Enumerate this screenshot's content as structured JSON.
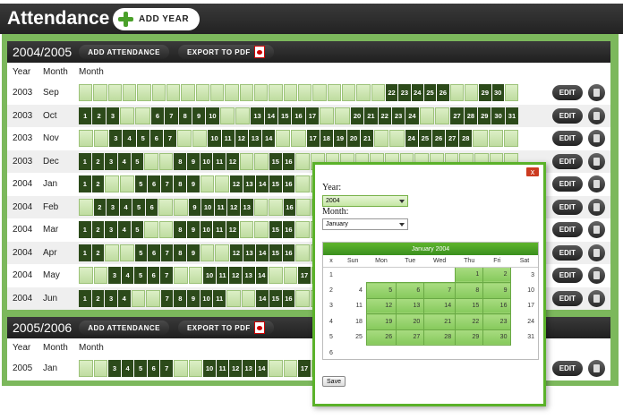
{
  "page": {
    "title": "Attendance",
    "add_year_label": "ADD YEAR"
  },
  "colors": {
    "header_bg": "#2b2b2b",
    "accent_green": "#7cb85c",
    "day_present": "#2c4a1a",
    "day_absent": "#cfe7b4"
  },
  "columns": {
    "year": "Year",
    "month": "Month",
    "days": "Month"
  },
  "section_buttons": {
    "add_attendance": "ADD ATTENDANCE",
    "export_pdf": "EXPORT TO PDF"
  },
  "row_actions": {
    "edit": "EDIT"
  },
  "sections": [
    {
      "title": "2004/2005",
      "rows": [
        {
          "year": "2003",
          "month": "Sep",
          "present": [
            22,
            23,
            24,
            25,
            26,
            29,
            30
          ]
        },
        {
          "year": "2003",
          "month": "Oct",
          "present": [
            1,
            2,
            3,
            6,
            7,
            8,
            9,
            10,
            13,
            14,
            15,
            16,
            17,
            20,
            21,
            22,
            23,
            24,
            27,
            28,
            29,
            30,
            31
          ]
        },
        {
          "year": "2003",
          "month": "Nov",
          "present": [
            3,
            4,
            5,
            6,
            7,
            10,
            11,
            12,
            13,
            14,
            17,
            18,
            19,
            20,
            21,
            24,
            25,
            26,
            27,
            28
          ]
        },
        {
          "year": "2003",
          "month": "Dec",
          "present": [
            1,
            2,
            3,
            4,
            5,
            8,
            9,
            10,
            11,
            12,
            15,
            16
          ]
        },
        {
          "year": "2004",
          "month": "Jan",
          "present": [
            1,
            2,
            5,
            6,
            7,
            8,
            9,
            12,
            13,
            14,
            15,
            16
          ]
        },
        {
          "year": "2004",
          "month": "Feb",
          "present": [
            2,
            3,
            4,
            5,
            6,
            9,
            10,
            11,
            12,
            13,
            16
          ]
        },
        {
          "year": "2004",
          "month": "Mar",
          "present": [
            1,
            2,
            3,
            4,
            5,
            8,
            9,
            10,
            11,
            12,
            15,
            16
          ]
        },
        {
          "year": "2004",
          "month": "Apr",
          "present": [
            1,
            2,
            5,
            6,
            7,
            8,
            9,
            12,
            13,
            14,
            15,
            16
          ]
        },
        {
          "year": "2004",
          "month": "May",
          "present": [
            3,
            4,
            5,
            6,
            7,
            10,
            11,
            12,
            13,
            14,
            17
          ]
        },
        {
          "year": "2004",
          "month": "Jun",
          "present": [
            1,
            2,
            3,
            4,
            7,
            8,
            9,
            10,
            11,
            14,
            15,
            16
          ]
        }
      ]
    },
    {
      "title": "2005/2006",
      "rows": [
        {
          "year": "2005",
          "month": "Jan",
          "present": [
            3,
            4,
            5,
            6,
            7,
            10,
            11,
            12,
            13,
            14,
            17
          ]
        }
      ]
    }
  ],
  "popup": {
    "close_label": "x",
    "year_label": "Year:",
    "year_value": "2004",
    "month_label": "Month:",
    "month_value": "January",
    "calendar_title": "January 2004",
    "week_col": "x",
    "weekdays": [
      "Sun",
      "Mon",
      "Tue",
      "Wed",
      "Thu",
      "Fri",
      "Sat"
    ],
    "weeks": [
      {
        "n": "1",
        "days": [
          "",
          "",
          "",
          "",
          "1",
          "2",
          "3"
        ]
      },
      {
        "n": "2",
        "days": [
          "4",
          "5",
          "6",
          "7",
          "8",
          "9",
          "10"
        ]
      },
      {
        "n": "3",
        "days": [
          "11",
          "12",
          "13",
          "14",
          "15",
          "16",
          "17"
        ]
      },
      {
        "n": "4",
        "days": [
          "18",
          "19",
          "20",
          "21",
          "22",
          "23",
          "24"
        ]
      },
      {
        "n": "5",
        "days": [
          "25",
          "26",
          "27",
          "28",
          "29",
          "30",
          "31"
        ]
      },
      {
        "n": "6",
        "days": [
          "",
          "",
          "",
          "",
          "",
          "",
          ""
        ]
      }
    ],
    "save_label": "Save"
  }
}
